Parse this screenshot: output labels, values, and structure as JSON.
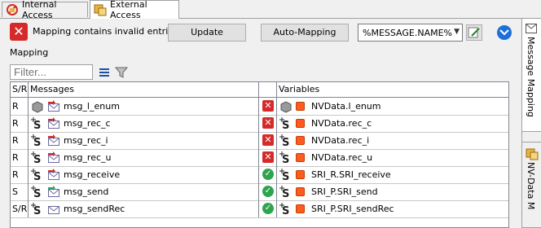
{
  "tabs": [
    {
      "label": "Internal Access",
      "icon": "internal-access-icon",
      "active": false
    },
    {
      "label": "External Access",
      "icon": "external-access-icon",
      "active": true
    }
  ],
  "toolbar": {
    "error_message": "Mapping contains invalid entries!",
    "update_label": "Update",
    "auto_mapping_label": "Auto-Mapping",
    "combo_value": "%MESSAGE.NAME%"
  },
  "mapping": {
    "group_label": "Mapping",
    "filter_placeholder": "Filter...",
    "columns": {
      "sr": "S/R",
      "messages": "Messages",
      "variables": "Variables"
    },
    "rows": [
      {
        "sr": "R",
        "message": "msg_l_enum",
        "status": "invalid",
        "variable": "NVData.l_enum"
      },
      {
        "sr": "R",
        "message": "msg_rec_c",
        "status": "invalid",
        "variable": "NVData.rec_c"
      },
      {
        "sr": "R",
        "message": "msg_rec_i",
        "status": "invalid",
        "variable": "NVData.rec_i"
      },
      {
        "sr": "R",
        "message": "msg_rec_u",
        "status": "invalid",
        "variable": "NVData.rec_u"
      },
      {
        "sr": "R",
        "message": "msg_receive",
        "status": "valid",
        "variable": "SRI_R.SRI_receive"
      },
      {
        "sr": "S",
        "message": "msg_send",
        "status": "valid",
        "variable": "SRI_P.SRI_send"
      },
      {
        "sr": "S/R",
        "message": "msg_sendRec",
        "status": "valid",
        "variable": "SRI_P.SRI_sendRec"
      }
    ]
  },
  "side_tabs": [
    {
      "label": "Message Mapping"
    },
    {
      "label": "NV-Data M"
    }
  ],
  "colors": {
    "error": "#d62a2a",
    "ok": "#2ea44f",
    "variable": "#ff5a1f",
    "accent": "#1e6fd9"
  }
}
